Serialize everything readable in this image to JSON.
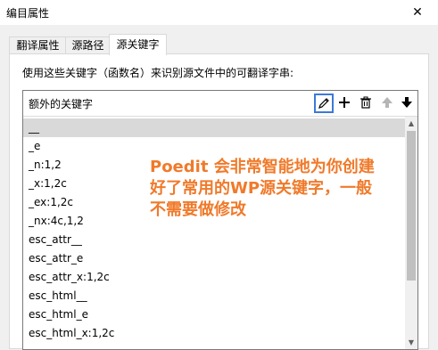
{
  "window": {
    "title": "编目属性",
    "close_glyph": "✕"
  },
  "tabs": [
    {
      "label": "翻译属性"
    },
    {
      "label": "源路径"
    },
    {
      "label": "源关键字"
    }
  ],
  "instruction": "使用这些关键字（函数名）来识别源文件中的可翻译字串:",
  "list": {
    "header": "额外的关键字",
    "toolbar": {
      "edit_icon": "pencil-icon",
      "add_icon": "plus-icon",
      "delete_icon": "trash-icon",
      "up_icon": "arrow-up-icon",
      "down_icon": "arrow-down-icon"
    },
    "items": [
      "__",
      "_e",
      "_n:1,2",
      "_x:1,2c",
      "_ex:1,2c",
      "_nx:4c,1,2",
      "esc_attr__",
      "esc_attr_e",
      "esc_attr_x:1,2c",
      "esc_html__",
      "esc_html_e",
      "esc_html_x:1,2c"
    ],
    "selected_index": 0
  },
  "annotation": "Poedit 会非常智能地为你创建好了常用的WP源关键字，一般不需要做修改",
  "colors": {
    "annotation": "#f07a2a",
    "focus": "#3b7ad9",
    "selection": "#d9d9d9"
  }
}
